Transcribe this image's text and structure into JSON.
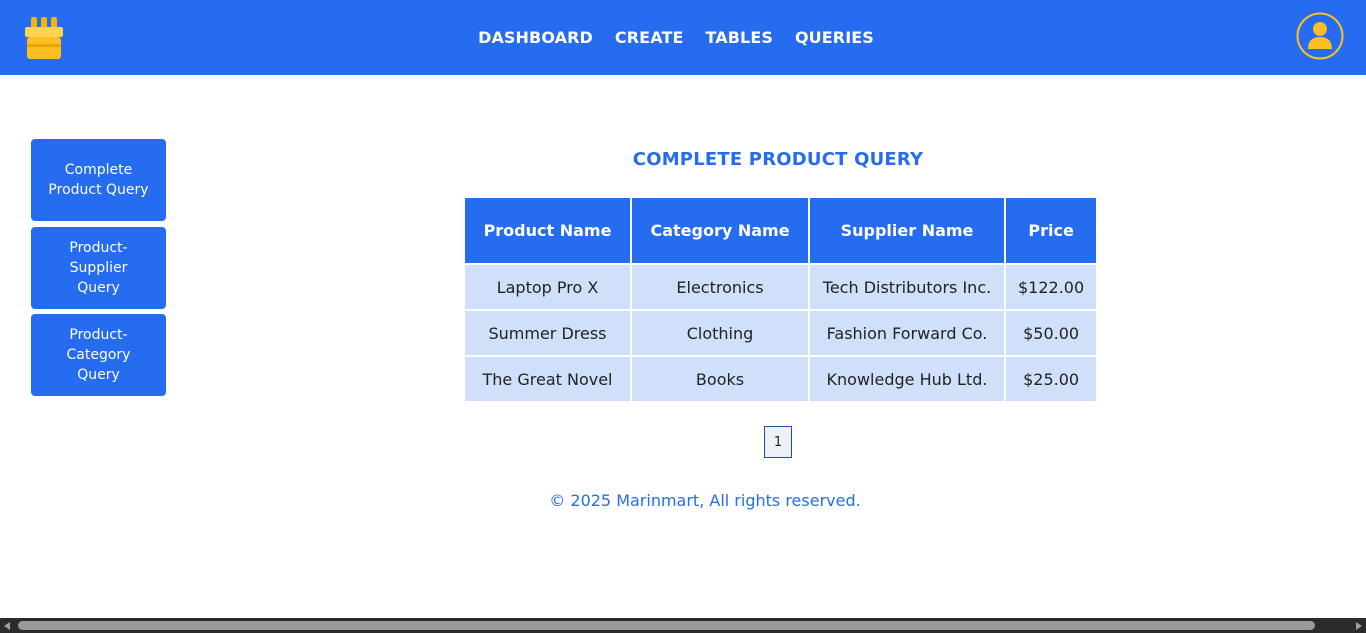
{
  "header": {
    "nav": [
      "DASHBOARD",
      "CREATE",
      "TABLES",
      "QUERIES"
    ],
    "logo_icon": "store-box-icon",
    "avatar_icon": "user-avatar-icon",
    "brand_color": "#256cf0",
    "logo_color": "#fbbf24"
  },
  "sidebar": {
    "items": [
      "Complete Product Query",
      "Product-Supplier Query",
      "Product-Category Query"
    ]
  },
  "main": {
    "title": "COMPLETE PRODUCT QUERY",
    "table": {
      "headers": [
        "Product Name",
        "Category Name",
        "Supplier Name",
        "Price"
      ],
      "rows": [
        [
          "Laptop Pro X",
          "Electronics",
          "Tech Distributors Inc.",
          "$122.00"
        ],
        [
          "Summer Dress",
          "Clothing",
          "Fashion Forward Co.",
          "$50.00"
        ],
        [
          "The Great Novel",
          "Books",
          "Knowledge Hub Ltd.",
          "$25.00"
        ]
      ]
    },
    "pagination": {
      "current_page": "1"
    }
  },
  "footer": {
    "text": "© 2025 Marinmart, All rights reserved."
  }
}
